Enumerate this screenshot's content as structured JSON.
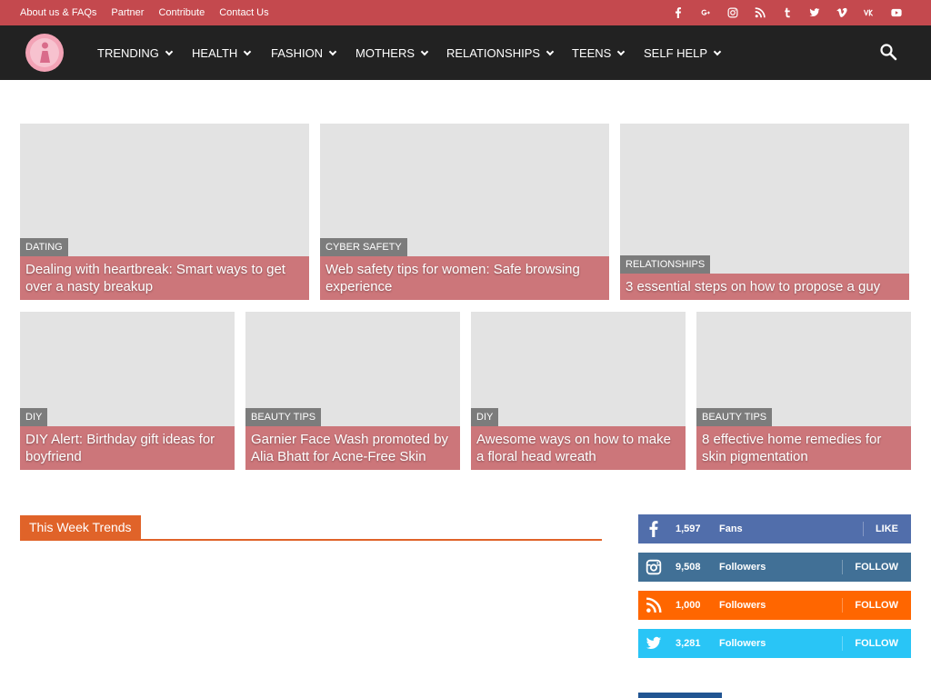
{
  "topbar": {
    "links": [
      {
        "label": "About us & FAQs"
      },
      {
        "label": "Partner"
      },
      {
        "label": "Contribute"
      },
      {
        "label": "Contact Us"
      }
    ],
    "social_icons": [
      "facebook-icon",
      "google-plus-icon",
      "instagram-icon",
      "rss-icon",
      "tumblr-icon",
      "twitter-icon",
      "vimeo-icon",
      "vk-icon",
      "youtube-icon"
    ]
  },
  "header": {
    "logo_icon": "site-logo",
    "nav": [
      {
        "label": "TRENDING",
        "icon": "chevron-down-icon"
      },
      {
        "label": "HEALTH",
        "icon": "chevron-down-icon"
      },
      {
        "label": "FASHION",
        "icon": "chevron-down-icon"
      },
      {
        "label": "MOTHERS",
        "icon": "chevron-down-icon"
      },
      {
        "label": "RELATIONSHIPS",
        "icon": "chevron-down-icon"
      },
      {
        "label": "TEENS",
        "icon": "chevron-down-icon"
      },
      {
        "label": "SELF HELP",
        "icon": "chevron-down-icon"
      }
    ],
    "search_icon": "search-icon"
  },
  "featured": {
    "row1": [
      {
        "category": "DATING",
        "title": "Dealing with heartbreak: Smart ways to get over a nasty breakup"
      },
      {
        "category": "CYBER SAFETY",
        "title": "Web safety tips for women: Safe browsing experience"
      },
      {
        "category": "RELATIONSHIPS",
        "title": "3 essential steps on how to propose a guy"
      }
    ],
    "row2": [
      {
        "category": "DIY",
        "title": "DIY Alert: Birthday gift ideas for boyfriend"
      },
      {
        "category": "BEAUTY TIPS",
        "title": "Garnier Face Wash promoted by Alia Bhatt for Acne-Free Skin"
      },
      {
        "category": "DIY",
        "title": "Awesome ways on how to make a floral head wreath"
      },
      {
        "category": "BEAUTY TIPS",
        "title": "8 effective home remedies for skin pigmentation"
      }
    ]
  },
  "block": {
    "title": "This Week Trends"
  },
  "social_counters": [
    {
      "icon": "facebook-icon",
      "count": "1,597",
      "label": "Fans",
      "button": "LIKE",
      "color": "#516eab"
    },
    {
      "icon": "instagram-icon",
      "count": "9,508",
      "label": "Followers",
      "button": "FOLLOW",
      "color": "#417096"
    },
    {
      "icon": "rss-icon",
      "count": "1,000",
      "label": "Followers",
      "button": "FOLLOW",
      "color": "#ff6600"
    },
    {
      "icon": "twitter-icon",
      "count": "3,281",
      "label": "Followers",
      "button": "FOLLOW",
      "color": "#29c5f6"
    }
  ],
  "colors": {
    "topbar": "#c4494e",
    "header": "#222222",
    "title_overlay": "#cc767a",
    "category_tag": "#7c7c7c",
    "block_accent": "#e06329",
    "thumbnail_placeholder": "#e3e3e3",
    "sidebar_block": "#215592"
  }
}
